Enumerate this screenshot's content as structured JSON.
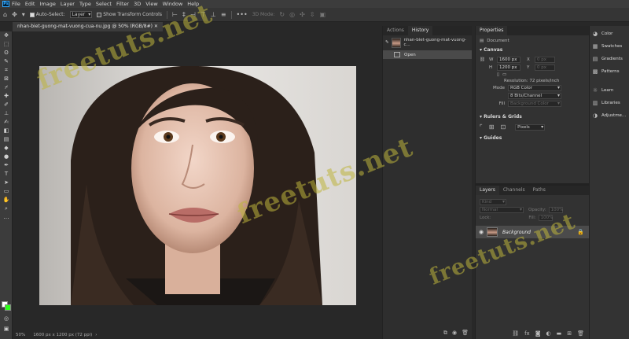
{
  "app": {
    "logo": "Ps"
  },
  "menu": [
    "File",
    "Edit",
    "Image",
    "Layer",
    "Type",
    "Select",
    "Filter",
    "3D",
    "View",
    "Window",
    "Help"
  ],
  "options": {
    "auto_select_label": "Auto-Select:",
    "auto_select_target": "Layer",
    "transform_controls_label": "Show Transform Controls",
    "mode_3d": "3D Mode:"
  },
  "document": {
    "tab_title": "nhan-biet-guong-mat-vuong-cua-nu.jpg @ 50% (RGB/8#)",
    "zoom": "50%",
    "status_info": "1600 px x 1200 px (72 ppi)"
  },
  "history_panel": {
    "tabs": [
      "Actions",
      "History"
    ],
    "active_tab": "History",
    "snapshot_name": "nhan-biet-guong-mat-vuong-c...",
    "steps": [
      "Open"
    ]
  },
  "properties_panel": {
    "title": "Properties",
    "doc_label": "Document",
    "canvas_section": "Canvas",
    "width_label": "W",
    "width_value": "1600 px",
    "height_label": "H",
    "height_value": "1200 px",
    "x_label": "X",
    "x_value": "0 px",
    "y_label": "Y",
    "y_value": "0 px",
    "resolution": "Resolution: 72 pixels/inch",
    "mode_label": "Mode",
    "mode_value": "RGB Color",
    "depth_value": "8 Bits/Channel",
    "fill_label": "Fill",
    "fill_value": "Background Color",
    "rulers_section": "Rulers & Grids",
    "units_value": "Pixels",
    "guides_section": "Guides"
  },
  "layers_panel": {
    "tabs": [
      "Layers",
      "Channels",
      "Paths"
    ],
    "active_tab": "Layers",
    "filter_kind": "Kind",
    "blend_mode": "Normal",
    "opacity_label": "Opacity:",
    "opacity_value": "100%",
    "lock_label": "Lock:",
    "fill_label": "Fill:",
    "fill_value": "100%",
    "layers": [
      {
        "name": "Background",
        "locked": true,
        "visible": true
      }
    ]
  },
  "right_dock": [
    "Color",
    "Swatches",
    "Gradients",
    "Patterns",
    "Learn",
    "Libraries",
    "Adjustme..."
  ],
  "watermark": "freetuts.net",
  "colors": {
    "foreground": "#ffffff",
    "background": "#2bff18",
    "accent": "#31a8ff"
  }
}
